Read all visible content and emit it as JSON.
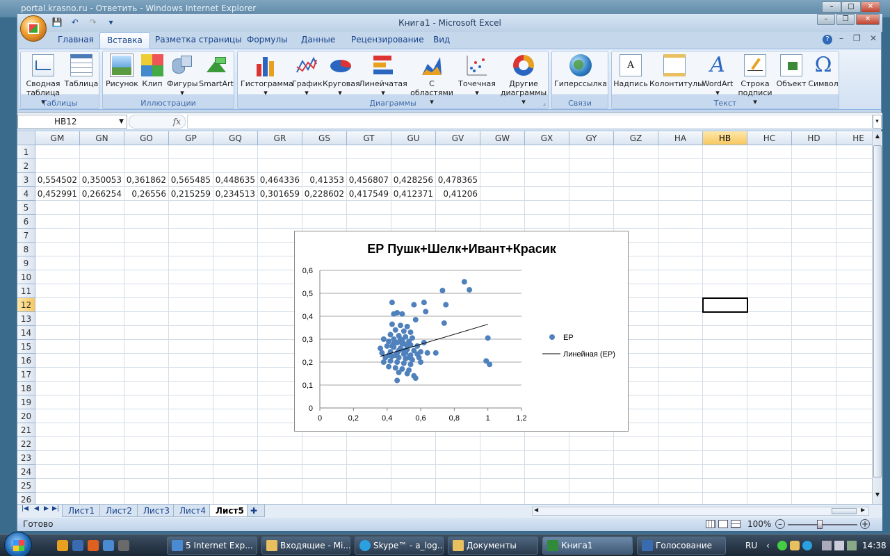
{
  "ie_window": {
    "title": "portal.krasno.ru - Ответить - Windows Internet Explorer"
  },
  "excel": {
    "title": "Книга1 - Microsoft Excel",
    "tabs": [
      "Главная",
      "Вставка",
      "Разметка страницы",
      "Формулы",
      "Данные",
      "Рецензирование",
      "Вид"
    ],
    "active_tab": "Вставка",
    "groups": {
      "tables": {
        "label": "Таблицы",
        "buttons": [
          "Сводная таблица",
          "Таблица"
        ]
      },
      "illustrations": {
        "label": "Иллюстрации",
        "buttons": [
          "Рисунок",
          "Клип",
          "Фигуры",
          "SmartArt"
        ]
      },
      "charts": {
        "label": "Диаграммы",
        "buttons": [
          "Гистограмма",
          "График",
          "Круговая",
          "Линейчатая",
          "С областями",
          "Точечная",
          "Другие диаграммы"
        ]
      },
      "links": {
        "label": "Связи",
        "buttons": [
          "Гиперссылка"
        ]
      },
      "text": {
        "label": "Текст",
        "buttons": [
          "Надпись",
          "Колонтитулы",
          "WordArt",
          "Строка подписи",
          "Объект",
          "Символ"
        ]
      }
    },
    "name_box": "HB12",
    "fx_label": "fx",
    "columns": [
      "GM",
      "GN",
      "GO",
      "GP",
      "GQ",
      "GR",
      "GS",
      "GT",
      "GU",
      "GV",
      "GW",
      "GX",
      "GY",
      "GZ",
      "HA",
      "HB",
      "HC",
      "HD",
      "HE"
    ],
    "selected_column": "HB",
    "rows": [
      "1",
      "2",
      "3",
      "4",
      "5",
      "6",
      "7",
      "8",
      "9",
      "10",
      "11",
      "12",
      "13",
      "14",
      "15",
      "16",
      "17",
      "18",
      "19",
      "20",
      "21",
      "22",
      "23",
      "24",
      "25",
      "26"
    ],
    "selected_row": "12",
    "row3": [
      "0,554502",
      "0,350053",
      "0,361862",
      "0,565485",
      "0,448635",
      "0,464336",
      "0,41353",
      "0,456807",
      "0,428256",
      "0,478365"
    ],
    "row4": [
      "0,452991",
      "0,266254",
      "0,26556",
      "0,215259",
      "0,234513",
      "0,301659",
      "0,228602",
      "0,417549",
      "0,412371",
      "0,41206"
    ],
    "sheets": [
      "Лист1",
      "Лист2",
      "Лист3",
      "Лист4",
      "Лист5"
    ],
    "active_sheet": "Лист5",
    "status": "Готово",
    "zoom": "100%"
  },
  "chart_data": {
    "type": "scatter",
    "title": "ЕР Пушк+Шелк+Ивант+Красик",
    "xlabel": "",
    "ylabel": "",
    "xlim": [
      0,
      1.2
    ],
    "ylim": [
      0,
      0.6
    ],
    "x_ticks": [
      "0",
      "0,2",
      "0,4",
      "0,6",
      "0,8",
      "1",
      "1,2"
    ],
    "y_ticks": [
      "0",
      "0,1",
      "0,2",
      "0,3",
      "0,4",
      "0,5",
      "0,6"
    ],
    "grid": "horizontal",
    "legend": "right",
    "series": [
      {
        "name": "ЕР",
        "color": "#4f81bd",
        "points": [
          [
            0.86,
            0.55
          ],
          [
            0.89,
            0.515
          ],
          [
            0.73,
            0.512
          ],
          [
            0.43,
            0.46
          ],
          [
            0.62,
            0.46
          ],
          [
            0.56,
            0.45
          ],
          [
            0.75,
            0.45
          ],
          [
            0.46,
            0.415
          ],
          [
            0.44,
            0.41
          ],
          [
            0.49,
            0.41
          ],
          [
            0.63,
            0.42
          ],
          [
            0.57,
            0.385
          ],
          [
            0.43,
            0.365
          ],
          [
            0.48,
            0.36
          ],
          [
            0.52,
            0.355
          ],
          [
            0.74,
            0.37
          ],
          [
            0.45,
            0.34
          ],
          [
            0.5,
            0.335
          ],
          [
            0.54,
            0.33
          ],
          [
            0.42,
            0.32
          ],
          [
            0.47,
            0.315
          ],
          [
            0.51,
            0.31
          ],
          [
            0.55,
            0.305
          ],
          [
            0.44,
            0.3
          ],
          [
            0.49,
            0.295
          ],
          [
            0.53,
            0.29
          ],
          [
            0.38,
            0.3
          ],
          [
            0.41,
            0.29
          ],
          [
            0.46,
            0.285
          ],
          [
            0.5,
            0.28
          ],
          [
            0.54,
            0.275
          ],
          [
            0.58,
            0.27
          ],
          [
            0.62,
            0.285
          ],
          [
            0.36,
            0.26
          ],
          [
            0.4,
            0.27
          ],
          [
            0.44,
            0.265
          ],
          [
            0.48,
            0.26
          ],
          [
            0.52,
            0.255
          ],
          [
            0.56,
            0.25
          ],
          [
            0.6,
            0.245
          ],
          [
            0.37,
            0.24
          ],
          [
            0.42,
            0.245
          ],
          [
            0.46,
            0.24
          ],
          [
            0.5,
            0.235
          ],
          [
            0.54,
            0.23
          ],
          [
            0.58,
            0.235
          ],
          [
            0.64,
            0.24
          ],
          [
            0.69,
            0.24
          ],
          [
            0.39,
            0.22
          ],
          [
            0.43,
            0.225
          ],
          [
            0.47,
            0.22
          ],
          [
            0.51,
            0.215
          ],
          [
            0.55,
            0.21
          ],
          [
            0.59,
            0.22
          ],
          [
            0.38,
            0.2
          ],
          [
            0.42,
            0.205
          ],
          [
            0.46,
            0.2
          ],
          [
            0.5,
            0.195
          ],
          [
            0.54,
            0.19
          ],
          [
            0.6,
            0.2
          ],
          [
            0.41,
            0.18
          ],
          [
            0.45,
            0.175
          ],
          [
            0.49,
            0.17
          ],
          [
            0.53,
            0.165
          ],
          [
            0.47,
            0.155
          ],
          [
            0.52,
            0.15
          ],
          [
            0.56,
            0.14
          ],
          [
            0.57,
            0.13
          ],
          [
            0.46,
            0.12
          ],
          [
            0.44,
            0.28
          ],
          [
            0.48,
            0.3
          ],
          [
            0.5,
            0.25
          ],
          [
            0.45,
            0.23
          ],
          [
            0.43,
            0.27
          ],
          [
            0.52,
            0.27
          ],
          [
            0.47,
            0.25
          ],
          [
            0.49,
            0.28
          ],
          [
            0.51,
            0.24
          ],
          [
            0.41,
            0.23
          ],
          [
            0.53,
            0.22
          ],
          [
            1.0,
            0.305
          ],
          [
            0.99,
            0.205
          ],
          [
            1.01,
            0.19
          ]
        ]
      }
    ],
    "trendline": {
      "name": "Линейная (ЕР)",
      "from": [
        0.36,
        0.225
      ],
      "to": [
        1.0,
        0.365
      ]
    }
  },
  "taskbar": {
    "tasks": [
      "5 Internet Exp...",
      "Входящие - Mi...",
      "Skype™ - a_log...",
      "Документы",
      "Книга1",
      "Голосование"
    ],
    "active_task": "Книга1",
    "lang": "RU",
    "clock": "14:38"
  }
}
